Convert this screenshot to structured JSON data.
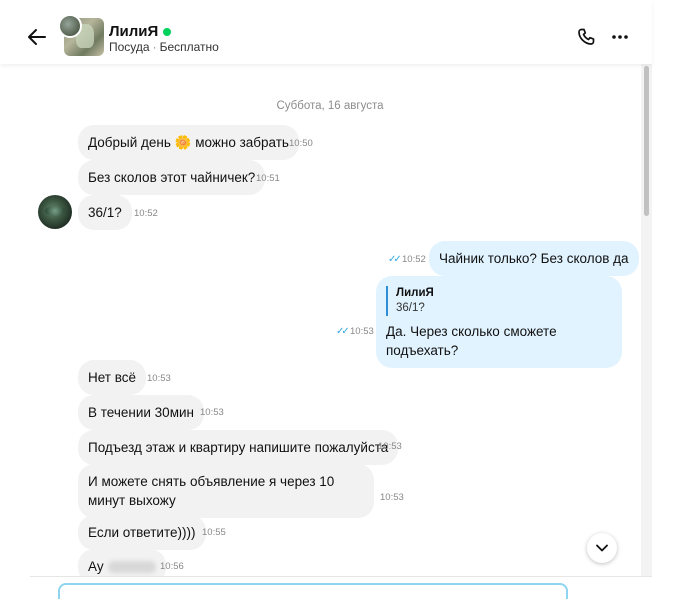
{
  "header": {
    "user_name": "ЛилиЯ",
    "listing_title": "Посуда",
    "listing_separator": "·",
    "listing_price": "Бесплатно",
    "online_color": "#02d15c"
  },
  "chat": {
    "date_separator": "Суббота, 16 августа",
    "messages": [
      {
        "text": "Добрый день 🌼 можно забрать",
        "time": "10:50"
      },
      {
        "text": "Без сколов этот чайничек?",
        "time": "10:51"
      },
      {
        "text": "36/1?",
        "time": "10:52"
      },
      {
        "text": "Чайник только? Без сколов да",
        "time": "10:52"
      },
      {
        "quote_author": "ЛилиЯ",
        "quote_text": "36/1?",
        "text": "Да. Через сколько сможете подъехать?",
        "time": "10:53"
      },
      {
        "text": "Нет всё",
        "time": "10:53"
      },
      {
        "text": "В течении 30мин",
        "time": "10:53"
      },
      {
        "text": "Подъезд этаж и квартиру напишите пожалуйста",
        "time": "10:53"
      },
      {
        "text": "И можете снять объявление я через 10 минут выхожу",
        "time": "10:53"
      },
      {
        "text": "Если ответите))))",
        "time": "10:55"
      },
      {
        "text": "Ау",
        "time": "10:56"
      }
    ]
  },
  "icons": {
    "back": "arrow-left-icon",
    "call": "phone-icon",
    "more": "more-dots-icon",
    "scroll_down": "chevron-down-icon",
    "read_ticks": "double-check-icon"
  },
  "colors": {
    "incoming_bubble": "#f2f2f2",
    "outgoing_bubble": "#e1f3ff",
    "read_tick": "#2fa8e0",
    "quote_bar": "#2f8fd6"
  }
}
